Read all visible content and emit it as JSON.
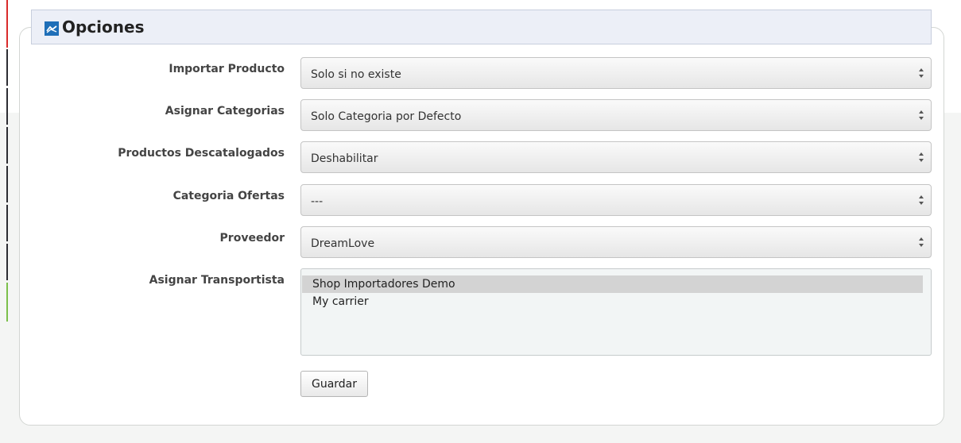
{
  "panel": {
    "title": "Opciones",
    "icon": "options-panel-icon"
  },
  "fields": {
    "importar_producto": {
      "label": "Importar Producto",
      "value": "Solo si no existe"
    },
    "asignar_categorias": {
      "label": "Asignar Categorias",
      "value": "Solo Categoria por Defecto"
    },
    "productos_descatalogados": {
      "label": "Productos Descatalogados",
      "value": "Deshabilitar"
    },
    "categoria_ofertas": {
      "label": "Categoria Ofertas",
      "value": "---"
    },
    "proveedor": {
      "label": "Proveedor",
      "value": "DreamLove"
    },
    "asignar_transportista": {
      "label": "Asignar Transportista",
      "options": [
        "Shop Importadores Demo",
        "My carrier"
      ],
      "selected": "Shop Importadores Demo"
    }
  },
  "actions": {
    "save_label": "Guardar"
  },
  "colors": {
    "legend_bg": "#eceff7",
    "legend_icon": "#1f6fb8",
    "side_red": "#d92b2b",
    "side_dark": "#2d2d33",
    "side_green": "#7bbf4a"
  }
}
